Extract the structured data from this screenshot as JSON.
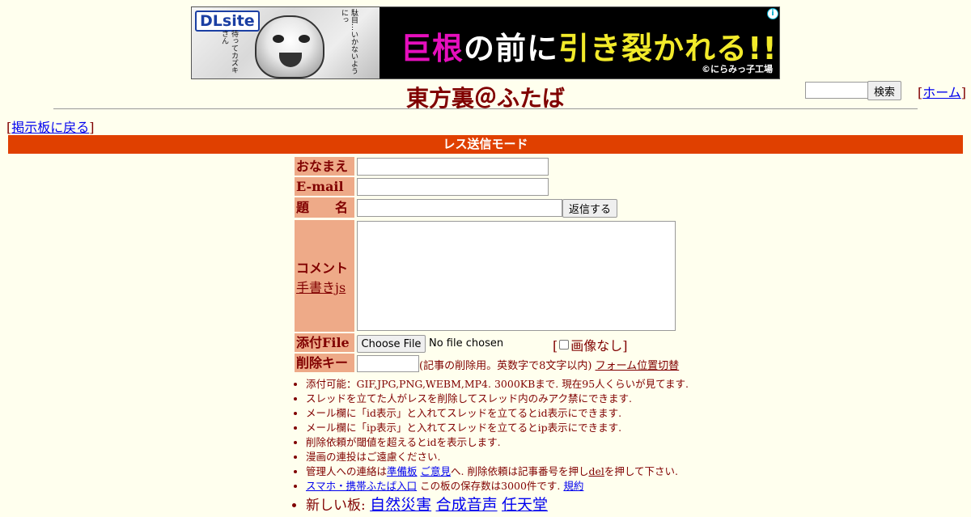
{
  "banner": {
    "logo": "DLsite",
    "caption_left": "待ってカズキさん",
    "caption_right": "駄目…いかないようにっ",
    "slogan_1": "巨根",
    "slogan_2": "の前に",
    "slogan_3": "引き裂かれる!!",
    "credit": "©にらみっ子工場",
    "info_icon": "i"
  },
  "header": {
    "title": "東方裏＠ふたば",
    "search_placeholder": "",
    "search_button": "検索",
    "home_link": "ホーム"
  },
  "nav": {
    "back_link": "掲示板に戻る"
  },
  "mode_bar": "レス送信モード",
  "form": {
    "name_label": "おなまえ",
    "email_label": "E-mail",
    "subject_label": "題　　名",
    "submit_button": "返信する",
    "comment_label": "コメント",
    "draw_link": "手書きjs",
    "file_label": "添付File",
    "choose_file_button": "Choose File",
    "no_file_text": "No file chosen",
    "no_image_label": "画像なし",
    "delkey_label": "削除キー",
    "delkey_note": "(記事の削除用。英数字で8文字以内)",
    "form_position_link": "フォーム位置切替"
  },
  "notes": {
    "n1": "添付可能：GIF,JPG,PNG,WEBM,MP4. 3000KBまで. 現在95人くらいが見てます.",
    "n2": "スレッドを立てた人がレスを削除してスレッド内のみアク禁にできます.",
    "n3": "メール欄に「id表示」と入れてスレッドを立てるとid表示にできます.",
    "n4": "メール欄に「ip表示」と入れてスレッドを立てるとip表示にできます.",
    "n5": "削除依頼が閾値を超えるとidを表示します.",
    "n6": "漫画の連投はご遠慮ください.",
    "n7_pre": "管理人への連絡は",
    "n7_link1": "準備板",
    "n7_link2": "ご意見",
    "n7_mid": "へ. 削除依頼は記事番号を押し",
    "n7_del": "del",
    "n7_post": "を押して下さい.",
    "n8_link": "スマホ・携帯ふたば入口",
    "n8_mid": " この板の保存数は3000件です. ",
    "n8_rules": "規約",
    "new_boards_label": "新しい板: ",
    "board1": "自然災害",
    "board2": "合成音声",
    "board3": "任天堂"
  }
}
